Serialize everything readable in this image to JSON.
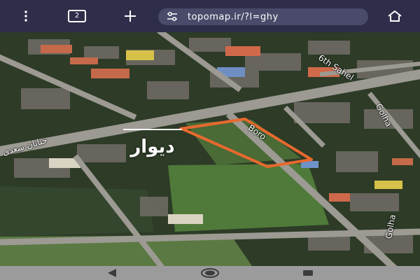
{
  "browser": {
    "url": "topomap.ir/?l=ghy",
    "tab_count": "2",
    "icons": {
      "menu": "more-vert-icon",
      "tabs": "tab-switcher-icon",
      "new_tab": "plus-icon",
      "url_prefix": "site-settings-icon",
      "home": "home-icon"
    }
  },
  "map": {
    "street_labels": {
      "sixth_street": "6th Sahel",
      "road_right": "Golha",
      "road_bottom": "Golha",
      "parcel_road": "Boro",
      "left_street": "خیابان سعدی"
    },
    "watermark_text": "دیوار",
    "parcel_outline_color": "#e8692e"
  },
  "system_nav": {
    "icons": {
      "back": "back-triangle-icon",
      "home": "home-circle-icon",
      "recents": "recents-square-icon"
    }
  }
}
